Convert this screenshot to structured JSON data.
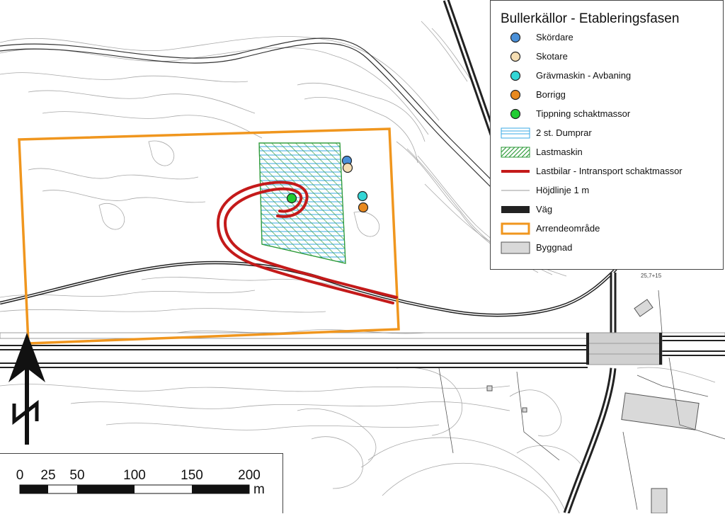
{
  "legend": {
    "title": "Bullerkällor - Etableringsfasen",
    "items": [
      {
        "label": "Skördare",
        "symbol": "circle",
        "color": "#4a90d9"
      },
      {
        "label": "Skotare",
        "symbol": "circle",
        "color": "#f5deb3"
      },
      {
        "label": "Grävmaskin - Avbaning",
        "symbol": "circle",
        "color": "#33d6d6"
      },
      {
        "label": "Borrigg",
        "symbol": "circle",
        "color": "#e8891e"
      },
      {
        "label": "Tippning schaktmassor",
        "symbol": "circle",
        "color": "#22cc33"
      },
      {
        "label": "2 st. Dumprar",
        "symbol": "hlines",
        "color": "#3aa8e6"
      },
      {
        "label": "Lastmaskin",
        "symbol": "hatch",
        "color": "#2e9b3a"
      },
      {
        "label": "Lastbilar - Intransport schaktmassor",
        "symbol": "thickline",
        "color": "#c41a1a"
      },
      {
        "label": "Höjdlinje 1 m",
        "symbol": "thinline",
        "color": "#999999"
      },
      {
        "label": "Väg",
        "symbol": "road",
        "color": "#222222"
      },
      {
        "label": "Arrendeområde",
        "symbol": "outline",
        "color": "#f0961e"
      },
      {
        "label": "Byggnad",
        "symbol": "fill",
        "color": "#d9d9d9"
      }
    ]
  },
  "scale_bar": {
    "ticks": [
      "0",
      "25",
      "50",
      "100",
      "150",
      "200"
    ],
    "unit": "m"
  },
  "road_label": "25,7+15"
}
